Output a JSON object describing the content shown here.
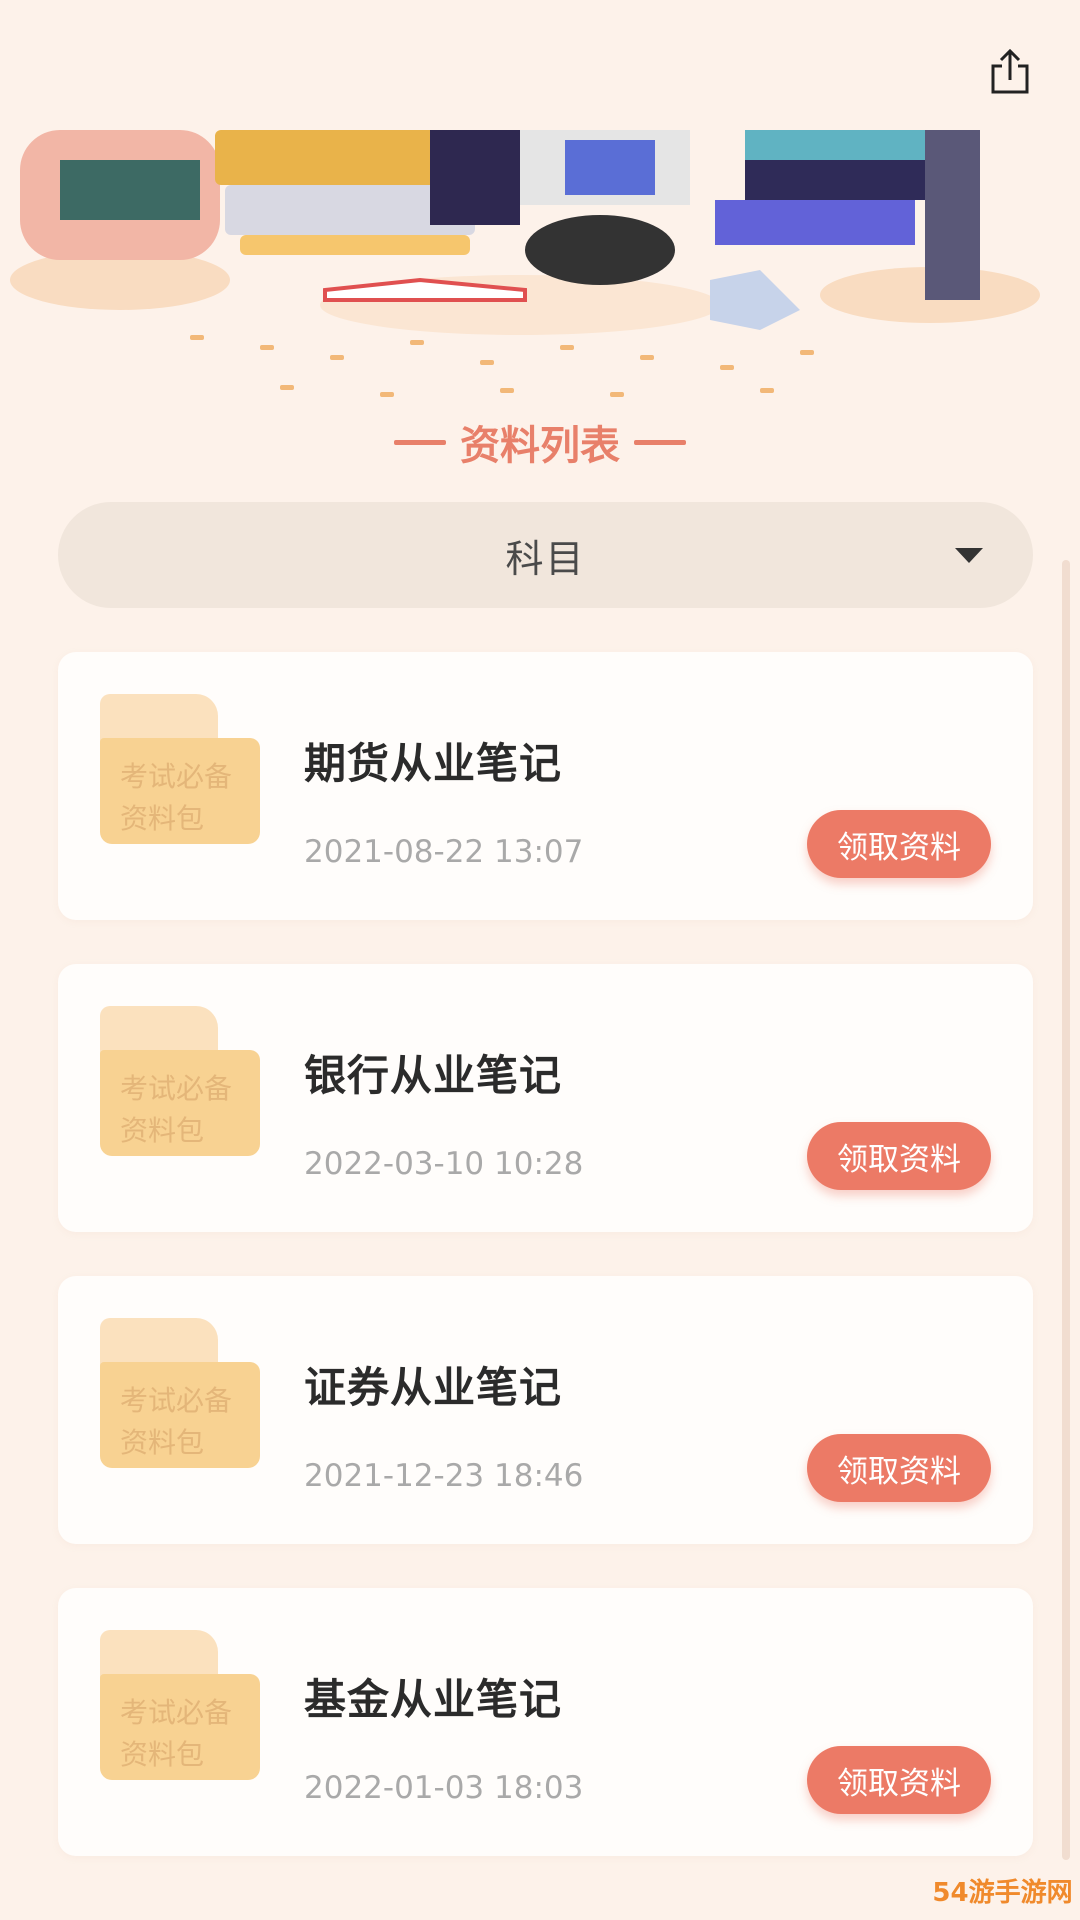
{
  "header": {
    "share_icon": "share-icon"
  },
  "section": {
    "title": "资料列表"
  },
  "filter": {
    "label": "科目",
    "caret_icon": "caret-down-icon"
  },
  "items": [
    {
      "folder_text_1": "考试必备",
      "folder_text_2": "资料包",
      "title": "期货从业笔记",
      "date": "2021-08-22 13:07",
      "button": "领取资料"
    },
    {
      "folder_text_1": "考试必备",
      "folder_text_2": "资料包",
      "title": "银行从业笔记",
      "date": "2022-03-10 10:28",
      "button": "领取资料"
    },
    {
      "folder_text_1": "考试必备",
      "folder_text_2": "资料包",
      "title": "证券从业笔记",
      "date": "2021-12-23 18:46",
      "button": "领取资料"
    },
    {
      "folder_text_1": "考试必备",
      "folder_text_2": "资料包",
      "title": "基金从业笔记",
      "date": "2022-01-03 18:03",
      "button": "领取资料"
    }
  ],
  "colors": {
    "accent": "#ec7a66",
    "background": "#fdf2ea",
    "folder": "#f8d292"
  },
  "watermark": "54游手游网"
}
